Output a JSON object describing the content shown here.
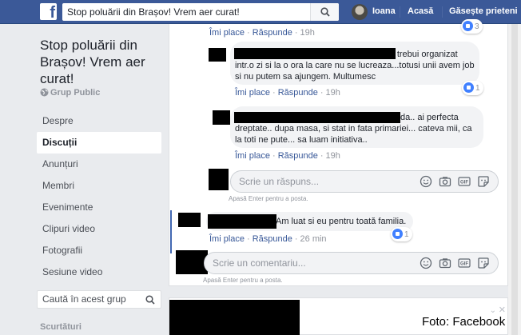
{
  "topbar": {
    "search_value": "Stop poluării din Brașov! Vrem aer curat!",
    "user_name": "Ioana",
    "home_label": "Acasă",
    "find_friends_label": "Găsește prieteni"
  },
  "group": {
    "name_line1": "Stop poluării din",
    "name_line2": "Brașov! Vrem aer",
    "name_line3": "curat!",
    "type": "Grup Public"
  },
  "nav": {
    "items": [
      {
        "label": "Despre"
      },
      {
        "label": "Discuții"
      },
      {
        "label": "Anunțuri"
      },
      {
        "label": "Membri"
      },
      {
        "label": "Evenimente"
      },
      {
        "label": "Clipuri video"
      },
      {
        "label": "Fotografii"
      },
      {
        "label": "Sesiune video"
      }
    ],
    "active": "Discuții",
    "group_search_placeholder": "Caută în acest grup",
    "shortcuts_label": "Scurtături"
  },
  "comments": {
    "top_actions": {
      "like": "Îmi place",
      "reply": "Răspunde",
      "time": "19h"
    },
    "reply1": {
      "line1": "ar trebui organizat",
      "line2": "intr.o zi si la o ora la care nu se lucreaza...totusi unii avem job",
      "line3": "si nu putem sa ajungem. Multumesc",
      "like": "Îmi place",
      "reply": "Răspunde",
      "time": "19h",
      "reactions": "1"
    },
    "reply2": {
      "line1": "da.. ai perfecta",
      "line2": "dreptate.. dupa masa, si stat in fata primariei... cateva mii, ca",
      "line3": "la toti ne pute... sa luam initiativa..",
      "like": "Îmi place",
      "reply": "Răspunde",
      "time": "19h"
    },
    "reply_input_placeholder": "Scrie un răspuns...",
    "reply_hint": "Apasă Enter pentru a posta.",
    "comment": {
      "text": "Am luat si eu pentru toată familia.",
      "like": "Îmi place",
      "reply": "Răspunde",
      "time": "26 min",
      "reactions": "1"
    },
    "comment_input_placeholder": "Scrie un comentariu...",
    "comment_hint": "Apasă Enter pentru a posta.",
    "top_reaction_count": "3"
  },
  "watermark": "Foto: Facebook",
  "colors": {
    "brand": "#3b5998",
    "link": "#385898",
    "page_bg": "#e9ebee",
    "bubble": "#f2f3f5"
  },
  "icons": [
    "facebook-logo-icon",
    "search-icon",
    "globe-icon",
    "like-icon",
    "emoji-icon",
    "camera-icon",
    "gif-icon",
    "sticker-icon"
  ]
}
